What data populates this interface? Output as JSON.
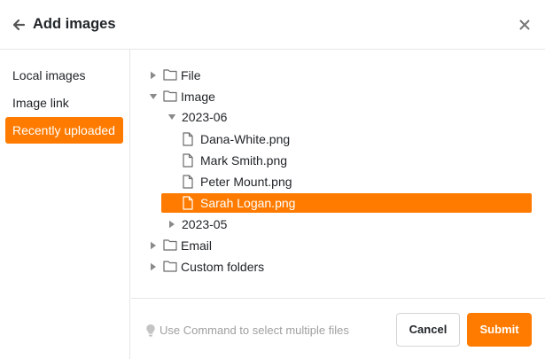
{
  "dialog": {
    "title": "Add images",
    "back_icon": "arrow-left-icon",
    "close_icon": "close-icon"
  },
  "sidebar": {
    "items": [
      {
        "label": "Local images",
        "active": false
      },
      {
        "label": "Image link",
        "active": false
      },
      {
        "label": "Recently uploaded",
        "active": true
      }
    ]
  },
  "tree": {
    "items": [
      {
        "label": "File",
        "kind": "folder",
        "expanded": false
      },
      {
        "label": "Image",
        "kind": "folder",
        "expanded": true
      },
      {
        "label": "2023-06",
        "kind": "subfolder",
        "expanded": true
      },
      {
        "label": "Dana-White.png",
        "kind": "file"
      },
      {
        "label": "Mark Smith.png",
        "kind": "file"
      },
      {
        "label": "Peter Mount.png",
        "kind": "file"
      },
      {
        "label": "Sarah Logan.png",
        "kind": "file",
        "selected": true
      },
      {
        "label": "2023-05",
        "kind": "subfolder",
        "expanded": false
      },
      {
        "label": "Email",
        "kind": "folder",
        "expanded": false
      },
      {
        "label": "Custom folders",
        "kind": "folder",
        "expanded": false
      }
    ]
  },
  "footer": {
    "hint": "Use Command to select multiple files",
    "hint_icon": "lightbulb-icon",
    "cancel_label": "Cancel",
    "submit_label": "Submit"
  },
  "colors": {
    "accent": "#ff7b00",
    "text": "#212529",
    "muted": "#a0a0a0",
    "border": "#e6e6e6"
  }
}
